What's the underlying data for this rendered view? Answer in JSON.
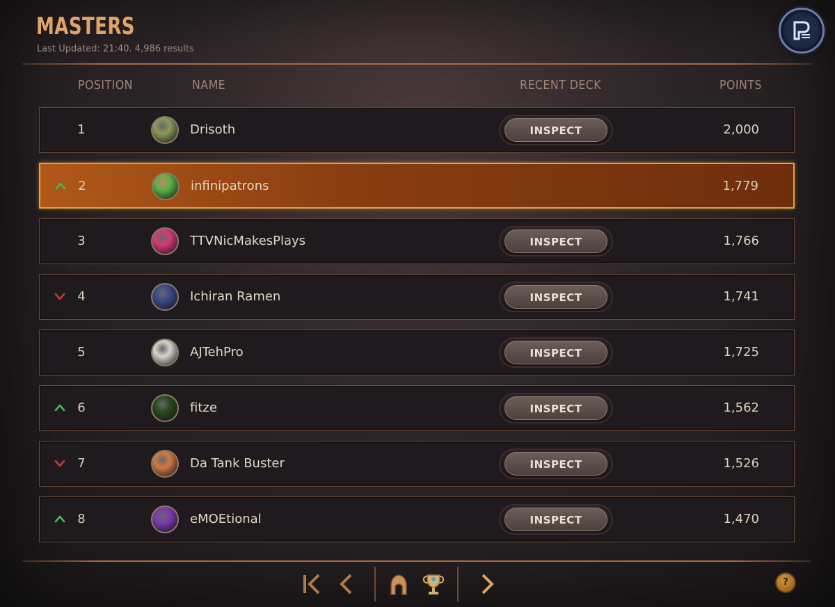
{
  "header": {
    "title": "MASTERS",
    "subtitle": "Last Updated: 21:40. 4,986 results"
  },
  "columns": {
    "position": "POSITION",
    "name": "NAME",
    "recent_deck": "RECENT DECK",
    "points": "POINTS"
  },
  "inspect_label": "INSPECT",
  "rows": [
    {
      "position": "1",
      "name": "Drisoth",
      "points": "2,000",
      "trend": "none",
      "inspect": true,
      "highlight": false,
      "avatar_icon": "yordle-avatar-icon",
      "avatar_color": "#8a9a5a"
    },
    {
      "position": "2",
      "name": "infinipatrons",
      "points": "1,779",
      "trend": "up",
      "inspect": false,
      "highlight": true,
      "avatar_icon": "green-creature-avatar-icon",
      "avatar_color": "#5db04a"
    },
    {
      "position": "3",
      "name": "TTVNicMakesPlays",
      "points": "1,766",
      "trend": "none",
      "inspect": true,
      "highlight": false,
      "avatar_icon": "pink-poro-avatar-icon",
      "avatar_color": "#d43a78"
    },
    {
      "position": "4",
      "name": "Ichiran Ramen",
      "points": "1,741",
      "trend": "down",
      "inspect": true,
      "highlight": false,
      "avatar_icon": "champion-portrait-avatar-icon",
      "avatar_color": "#3a4a8a"
    },
    {
      "position": "5",
      "name": "AJTehPro",
      "points": "1,725",
      "trend": "none",
      "inspect": true,
      "highlight": false,
      "avatar_icon": "poro-avatar-icon",
      "avatar_color": "#d8d4cc"
    },
    {
      "position": "6",
      "name": "fitze",
      "points": "1,562",
      "trend": "up",
      "inspect": true,
      "highlight": false,
      "avatar_icon": "plant-avatar-icon",
      "avatar_color": "#2a4a1a"
    },
    {
      "position": "7",
      "name": "Da Tank Buster",
      "points": "1,526",
      "trend": "down",
      "inspect": true,
      "highlight": false,
      "avatar_icon": "shield-emblem-avatar-icon",
      "avatar_color": "#d07a40"
    },
    {
      "position": "8",
      "name": "eMOEtional",
      "points": "1,470",
      "trend": "up",
      "inspect": true,
      "highlight": false,
      "avatar_icon": "purple-crest-avatar-icon",
      "avatar_color": "#7a3ab0"
    }
  ],
  "colors": {
    "title": "#e0a46a",
    "trend_up": "#3fbf5a",
    "trend_down": "#c83a3a",
    "highlight": "#b05818"
  },
  "icons": {
    "profile": "legends-of-runeterra-profile-icon",
    "first_page": "first-page-icon",
    "prev_page": "prev-page-icon",
    "region_filter": "region-filter-icon",
    "trophy": "trophy-icon",
    "next_page": "next-page-icon",
    "help": "help-icon"
  },
  "help_label": "?"
}
